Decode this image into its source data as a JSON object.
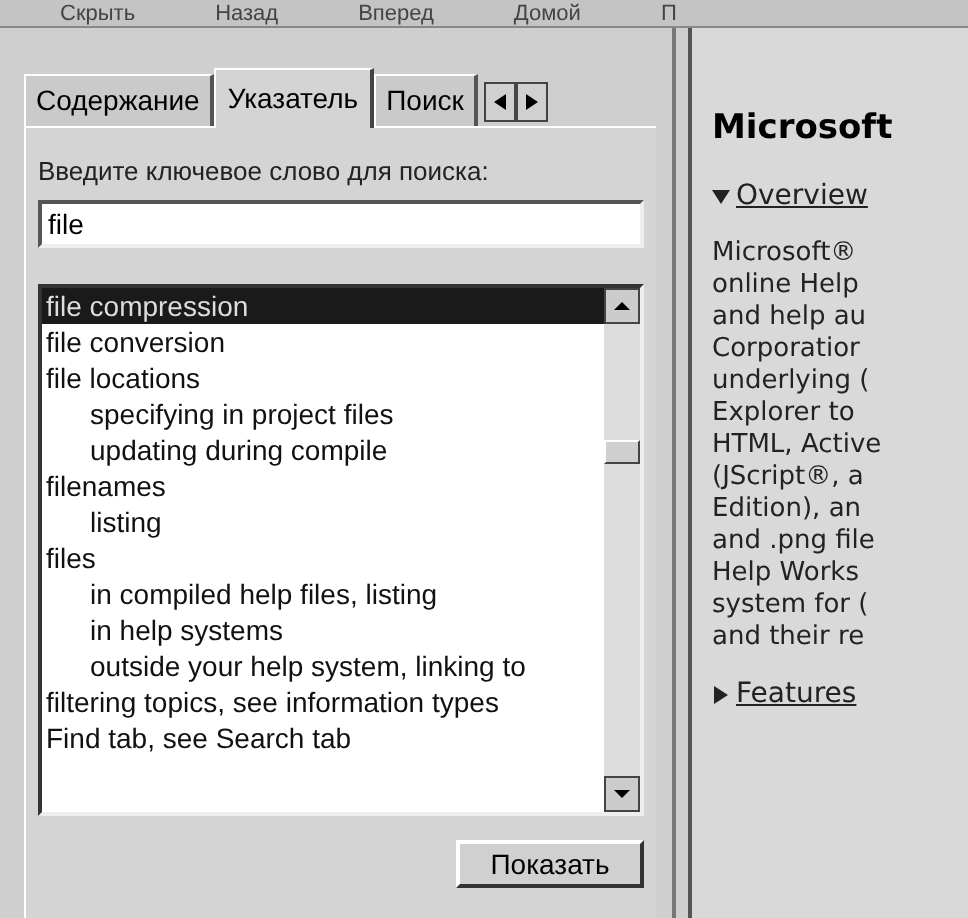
{
  "toolbar": [
    {
      "label": "Скрыть"
    },
    {
      "label": "Назад"
    },
    {
      "label": "Вперед"
    },
    {
      "label": "Домой"
    },
    {
      "label": "П"
    }
  ],
  "tabs": [
    {
      "label": "Содержание",
      "selected": false
    },
    {
      "label": "Указатель",
      "selected": true
    },
    {
      "label": "Поиск",
      "selected": false
    }
  ],
  "search": {
    "label": "Введите ключевое слово для поиска:",
    "value": "file"
  },
  "index": [
    {
      "label": "file compression",
      "selected": true
    },
    {
      "label": "file conversion",
      "selected": false
    },
    {
      "label": "file locations",
      "selected": false,
      "children": [
        {
          "label": "specifying in project files",
          "selected": false
        },
        {
          "label": "updating during compile",
          "selected": false
        }
      ]
    },
    {
      "label": "filenames",
      "selected": false,
      "children": [
        {
          "label": "listing",
          "selected": false
        }
      ]
    },
    {
      "label": "files",
      "selected": false,
      "children": [
        {
          "label": "in compiled help files, listing",
          "selected": false
        },
        {
          "label": "in help systems",
          "selected": false
        },
        {
          "label": "outside your help system, linking to",
          "selected": false
        }
      ]
    },
    {
      "label": "filtering topics, see information types",
      "selected": false
    },
    {
      "label": "Find tab, see Search tab",
      "selected": false
    }
  ],
  "show_button": "Показать",
  "topic": {
    "title": "Microsoft",
    "sections": [
      {
        "label": "Overview",
        "expanded": true,
        "lines": [
          "Microsoft®",
          "online Help",
          "and help au",
          "Corporatior",
          "underlying (",
          "Explorer to",
          "HTML, Active",
          "(JScript®, a",
          "Edition), an",
          "and .png file",
          "Help Works",
          "system for (",
          "and their re"
        ]
      },
      {
        "label": "Features",
        "expanded": false
      }
    ]
  }
}
